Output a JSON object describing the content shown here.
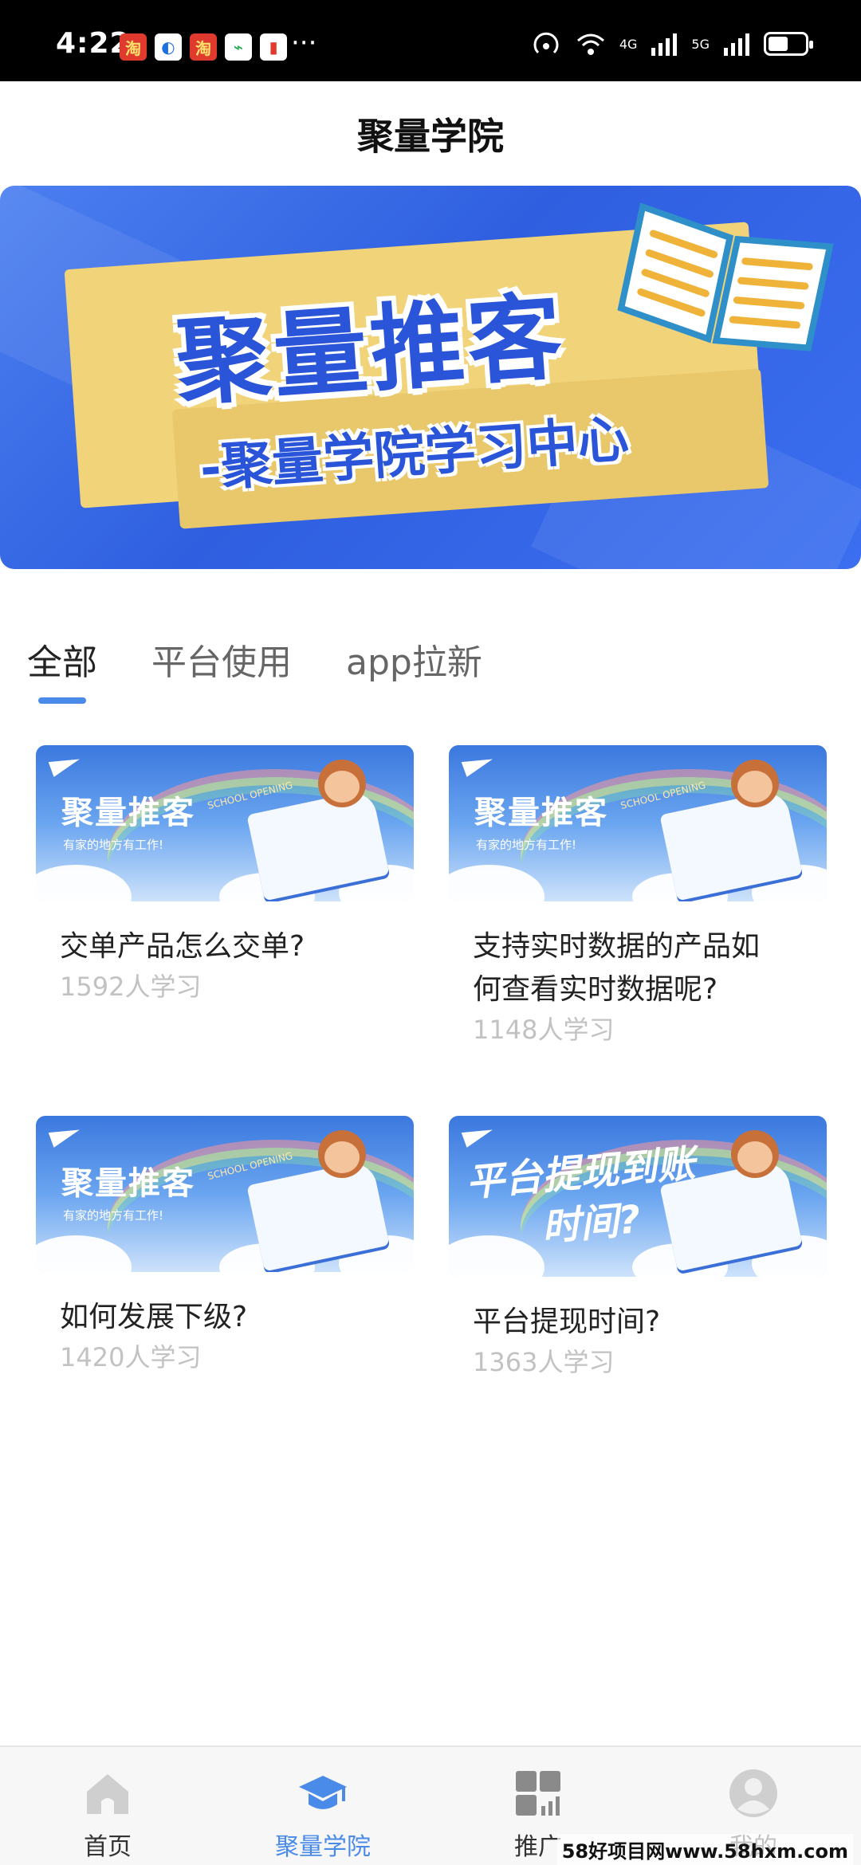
{
  "status_bar": {
    "time": "4:22",
    "app_badges": [
      "淘",
      "◐",
      "淘",
      "⌁",
      "▮"
    ],
    "more": "···",
    "network_4g": "4G",
    "network_5g": "5G",
    "battery_level": 0.55
  },
  "header": {
    "title": "聚量学院"
  },
  "banner": {
    "title": "聚量推客",
    "subtitle": "-聚量学院学习中心"
  },
  "tabs": [
    {
      "label": "全部",
      "active": true
    },
    {
      "label": "平台使用",
      "active": false
    },
    {
      "label": "app拉新",
      "active": false
    }
  ],
  "thumb_common": {
    "title": "聚量推客",
    "sub": "有家的地方有工作!",
    "school": "SCHOOL OPENING",
    "withdraw_title_line1": "平台提现到账",
    "withdraw_title_line2": "时间?"
  },
  "courses": [
    {
      "title": "交单产品怎么交单?",
      "learners": "1592人学习"
    },
    {
      "title": "支持实时数据的产品如何查看实时数据呢?",
      "learners": "1148人学习"
    },
    {
      "title": "如何发展下级?",
      "learners": "1420人学习"
    },
    {
      "title": "平台提现时间?",
      "learners": "1363人学习"
    }
  ],
  "bottom_nav": [
    {
      "label": "首页",
      "icon": "home-icon",
      "active": false
    },
    {
      "label": "聚量学院",
      "icon": "graduation-cap-icon",
      "active": true
    },
    {
      "label": "推广",
      "icon": "promote-grid-icon",
      "active": false
    },
    {
      "label": "我的",
      "icon": "profile-icon",
      "active": false
    }
  ],
  "colors": {
    "accent": "#4a8ae8",
    "banner_blue": "#2f5fe0",
    "banner_paper": "#f1d37a"
  },
  "watermark": "58好项目网www.58hxm.com"
}
